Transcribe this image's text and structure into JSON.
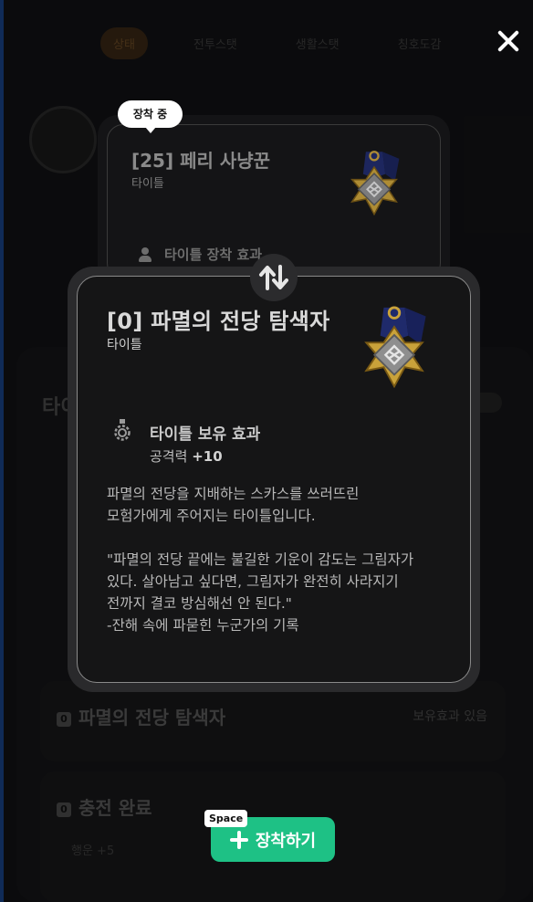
{
  "background": {
    "tabs": [
      "상태",
      "전투스탯",
      "생활스탯",
      "칭호도감"
    ],
    "heading": "타이틀",
    "list": [
      {
        "num": "0",
        "title": "파멸의 전당 탐색자",
        "tag": "보유효과 있음"
      },
      {
        "num": "0",
        "title": "충전 완료",
        "stat": "행운 +5"
      }
    ]
  },
  "equipped_card": {
    "badge": "장착 중",
    "title": "[25] 페리 사냥꾼",
    "type": "타이틀",
    "effect_label": "타이틀 장착 효과"
  },
  "detail_card": {
    "title": "[0] 파멸의 전당 탐색자",
    "type": "타이틀",
    "effect_title": "타이틀 보유 효과",
    "effect_stat": "공격력",
    "effect_value": "+10",
    "description": "파멸의 전당을 지배하는 스카스를 쓰러뜨린\n모험가에게 주어지는 타이틀입니다.\n\n\"파멸의 전당 끝에는 불길한 기운이 감도는 그림자가\n있다. 살아남고 싶다면, 그림자가 완전히 사라지기\n전까지 결코 방심해선 안 된다.\"\n-잔해 속에 파묻힌 누군가의 기록"
  },
  "equip_button": {
    "label": "장착하기",
    "shortcut": "Space"
  },
  "icons": {
    "close": "close-icon",
    "swap": "swap-icon",
    "medal": "medal-icon",
    "effect": "gear-icon",
    "person": "person-icon",
    "plus": "plus-icon"
  },
  "colors": {
    "accent": "#1ec185",
    "medal_gold": "#c9a23a",
    "medal_navy": "#1f2a6b"
  }
}
